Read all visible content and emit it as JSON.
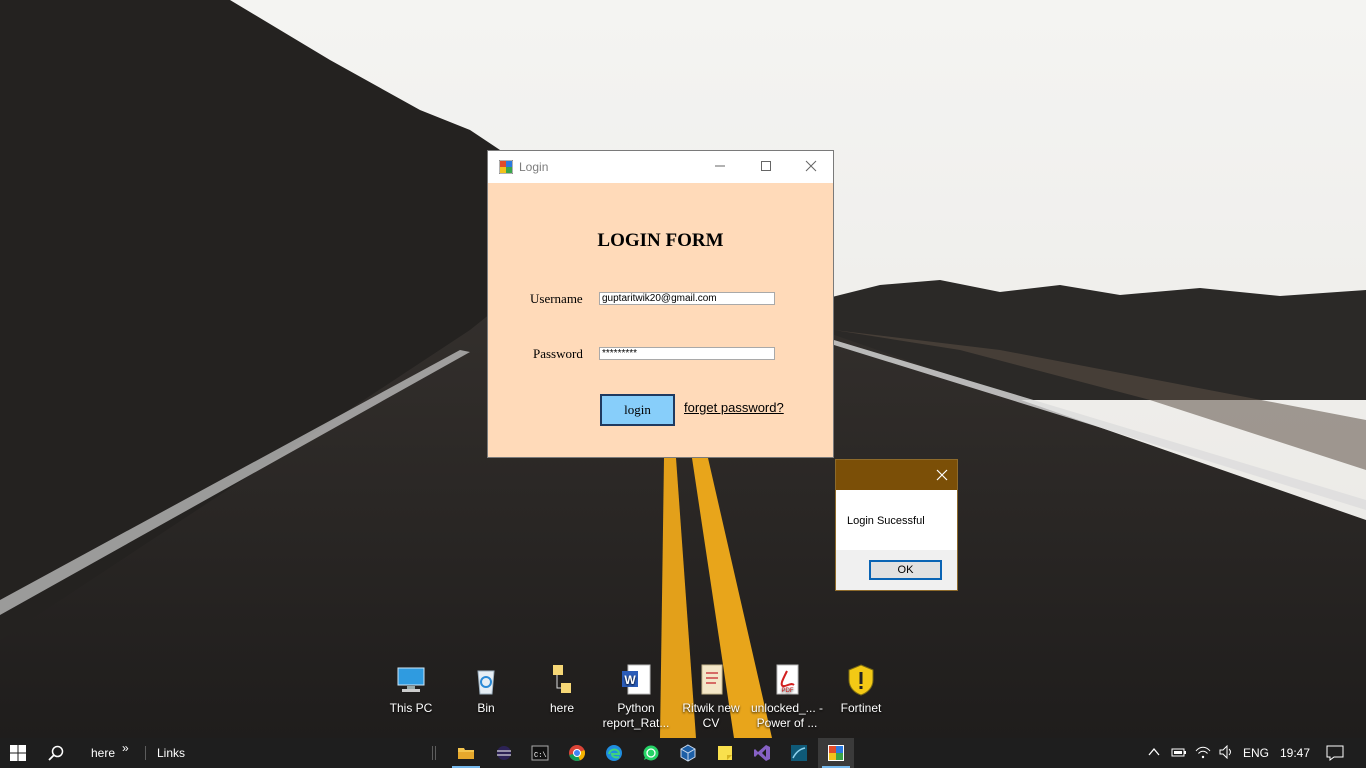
{
  "desktop": {
    "icons": [
      {
        "name": "this-pc-icon",
        "label": "This PC"
      },
      {
        "name": "recycle-bin-icon",
        "label": "Bin"
      },
      {
        "name": "here-folder-icon",
        "label": "here"
      },
      {
        "name": "word-document-icon",
        "label": "Python report_Rat..."
      },
      {
        "name": "pdf-document-icon",
        "label": "Ritwik new CV"
      },
      {
        "name": "pdf-document-icon-2",
        "label": "unlocked_... - Power of ..."
      },
      {
        "name": "fortinet-shield-icon",
        "label": "Fortinet"
      }
    ]
  },
  "login_window": {
    "title": "Login",
    "heading": "LOGIN FORM",
    "username_label": "Username",
    "username_value": "guptaritwik20@gmail.com",
    "password_label": "Password",
    "password_value": "*********",
    "login_button": "login",
    "forget_link": "forget password?",
    "background_color": "#ffdab9",
    "button_color": "#87cefa"
  },
  "message_box": {
    "message": "Login Sucessful",
    "ok_label": "OK",
    "titlebar_color": "#7b4f07"
  },
  "taskbar": {
    "toolbar_here": "here",
    "toolbar_chevron": "»",
    "toolbar_links": "Links",
    "apps": [
      "file-explorer-icon",
      "eclipse-icon",
      "command-prompt-icon",
      "chrome-icon",
      "edge-icon",
      "whatsapp-icon",
      "virtualbox-icon",
      "sticky-notes-icon",
      "visual-studio-icon",
      "network-app-icon",
      "login-form-app-icon"
    ],
    "language": "ENG",
    "time": "19:47"
  }
}
